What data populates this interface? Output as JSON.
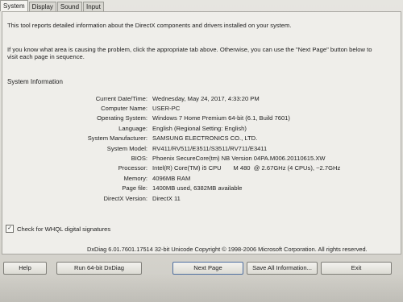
{
  "tabs": [
    "System",
    "Display",
    "Sound",
    "Input"
  ],
  "intro": {
    "line1": "This tool reports detailed information about the DirectX components and drivers installed on your system.",
    "line2": "If you know what area is causing the problem, click the appropriate tab above.  Otherwise, you can use the \"Next Page\" button below to",
    "line3": "visit each page in sequence."
  },
  "section_title": "System Information",
  "system_info": [
    {
      "label": "Current Date/Time:",
      "value": "Wednesday, May 24, 2017, 4:33:20 PM"
    },
    {
      "label": "Computer Name:",
      "value": "USER-PC"
    },
    {
      "label": "Operating System:",
      "value": "Windows 7 Home Premium 64-bit (6.1, Build 7601)"
    },
    {
      "label": "Language:",
      "value": "English (Regional Setting: English)"
    },
    {
      "label": "System Manufacturer:",
      "value": "SAMSUNG ELECTRONICS CO., LTD."
    },
    {
      "label": "System Model:",
      "value": "RV411/RV511/E3511/S3511/RV711/E3411"
    },
    {
      "label": "BIOS:",
      "value": "Phoenix SecureCore(tm) NB Version 04PA.M006.20110615.XW"
    },
    {
      "label": "Processor:",
      "value": "Intel(R) Core(TM) i5 CPU       M 480  @ 2.67GHz (4 CPUs), ~2.7GHz"
    },
    {
      "label": "Memory:",
      "value": "4096MB RAM"
    },
    {
      "label": "Page file:",
      "value": "1400MB used, 6382MB available"
    },
    {
      "label": "DirectX Version:",
      "value": "DirectX 11"
    }
  ],
  "whql": {
    "label": "Check for WHQL digital signatures",
    "checked": true
  },
  "copyright": "DxDiag 6.01.7601.17514 32-bit Unicode  Copyright © 1998-2006 Microsoft Corporation.  All rights reserved.",
  "buttons": {
    "help": "Help",
    "run64": "Run 64-bit DxDiag",
    "next": "Next Page",
    "save": "Save All Information...",
    "exit": "Exit"
  }
}
